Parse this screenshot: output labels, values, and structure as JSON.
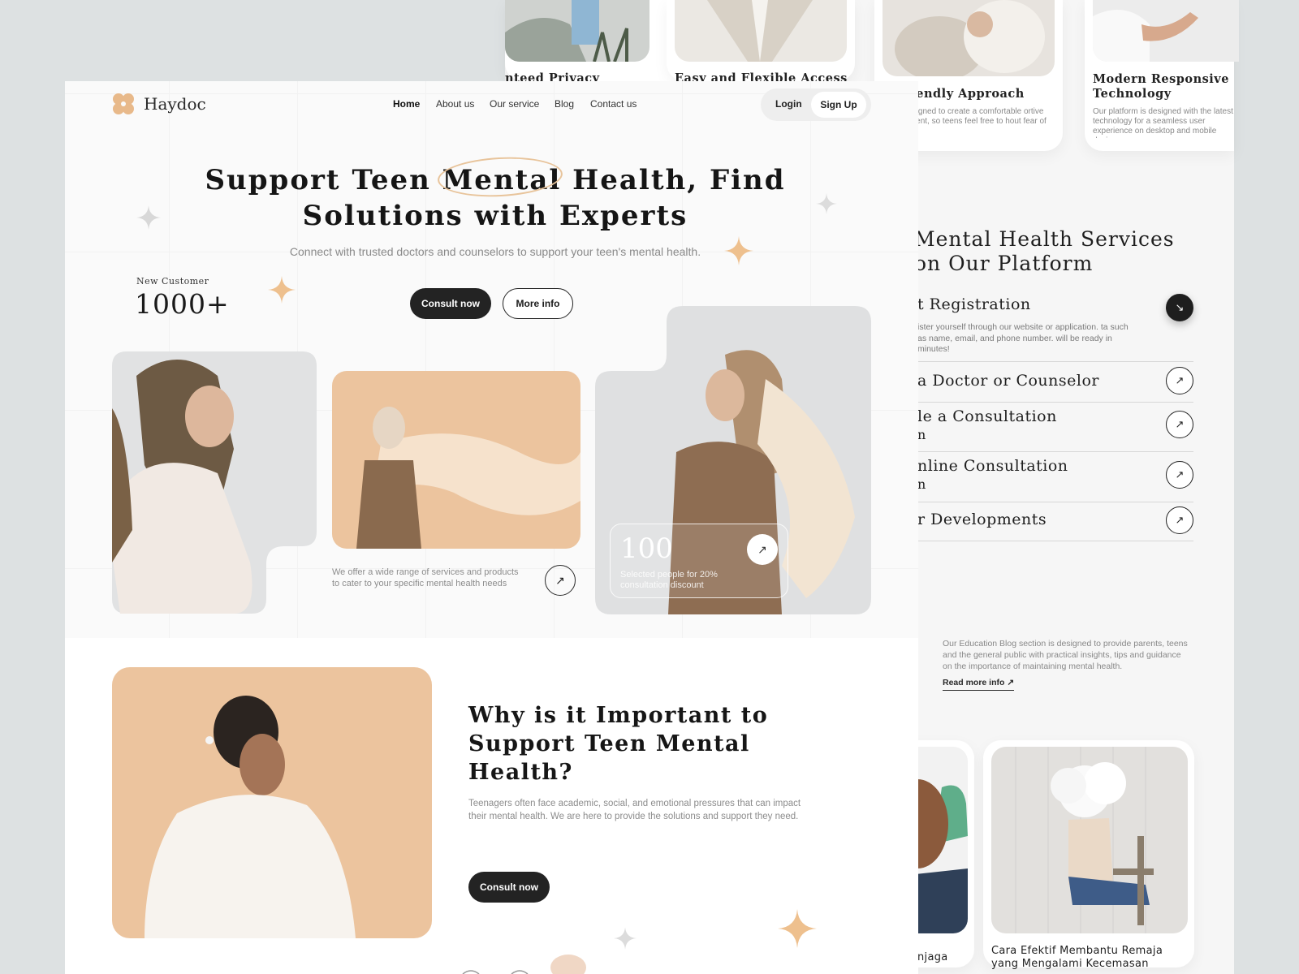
{
  "brand": {
    "name": "Haydoc",
    "accent": "#e9c49a",
    "dark": "#232323"
  },
  "nav": {
    "items": [
      "Home",
      "About us",
      "Our service",
      "Blog",
      "Contact us"
    ],
    "login": "Login",
    "signup": "Sign Up"
  },
  "hero": {
    "title_line1": "Support Teen Mental Health, Find",
    "title_line2": "Solutions with Experts",
    "subtitle": "Connect with trusted doctors and counselors to support your teen's mental health.",
    "consult_label": "Consult now",
    "more_info_label": "More info",
    "new_customer_label": "New Customer",
    "new_customer_value": "1000+",
    "services_desc": "We offer a wide range of services and products to cater to your specific mental health needs",
    "stat_value": "100",
    "stat_label": "Selected people for 20% consultation discount"
  },
  "why": {
    "title": "Why is it Important to Support Teen Mental Health?",
    "description": "Teenagers often face academic, social, and emotional pressures that can impact their mental health. We are here to provide the solutions and support they need.",
    "consult_label": "Consult now"
  },
  "features": [
    {
      "title": "nteed Privacy"
    },
    {
      "title": "Easy and Flexible Access"
    },
    {
      "title": "n Friendly Approach",
      "description": "ice is designed to create a comfortable ortive environment, so teens feel free to hout fear of judgment."
    },
    {
      "title": "Modern Responsive Technology",
      "description": "Our platform is designed with the latest technology for a seamless user experience on desktop and mobile devices."
    }
  ],
  "services": {
    "title": "Mental Health Services on Our Platform",
    "items": [
      {
        "title": "t Registration",
        "description": "ister yourself through our website or application. ta such as name, email, and phone number. will be ready in minutes!"
      },
      {
        "title": " a Doctor or Counselor"
      },
      {
        "title": "le a Consultation",
        "subtitle": "n"
      },
      {
        "title": "nline Consultation",
        "subtitle": "n"
      },
      {
        "title": "r Developments"
      }
    ]
  },
  "blog": {
    "description": "Our Education Blog section is designed to provide parents, teens and the general public with practical insights, tips and guidance on the importance of maintaining mental health.",
    "read_more": "Read more info",
    "posts": [
      {
        "title": "njaga"
      },
      {
        "title": "Cara Efektif Membantu Remaja yang Mengalami Kecemasan"
      }
    ]
  }
}
